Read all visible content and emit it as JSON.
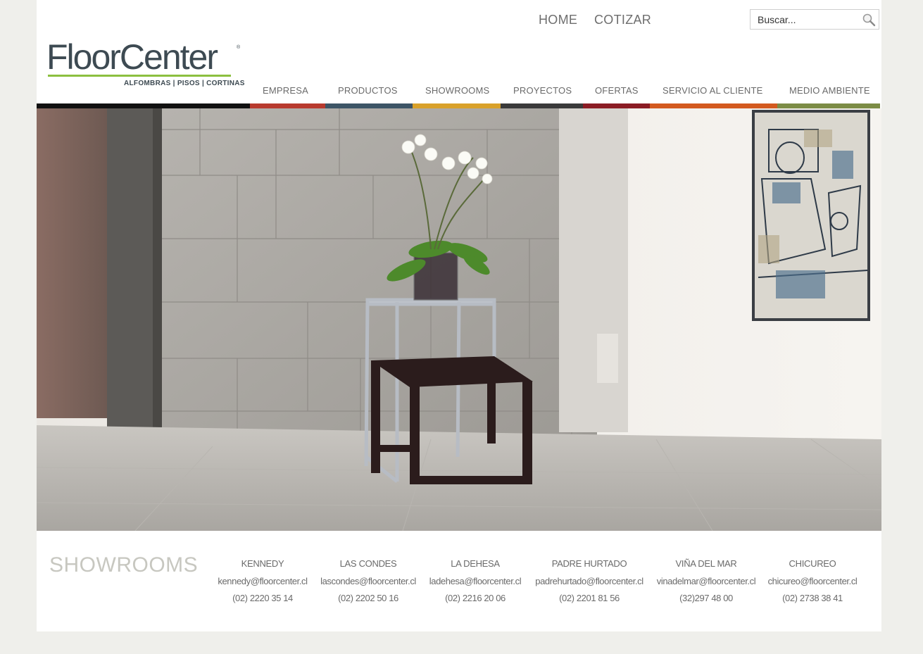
{
  "header": {
    "home_label": "HOME",
    "cotizar_label": "COTIZAR",
    "search_placeholder": "Buscar...",
    "logo_wordmark": "FloorCenter",
    "logo_tagline": "ALFOMBRAS | PISOS | CORTINAS"
  },
  "nav": {
    "items": [
      {
        "label": "EMPRESA",
        "color": "#b83a2e"
      },
      {
        "label": "PRODUCTOS",
        "color": "#3d5566"
      },
      {
        "label": "SHOWROOMS",
        "color": "#d9a12a"
      },
      {
        "label": "PROYECTOS",
        "color": "#3a3a3a"
      },
      {
        "label": "OFERTAS",
        "color": "#8b1c24"
      },
      {
        "label": "SERVICIO AL CLIENTE",
        "color": "#d35a1f"
      },
      {
        "label": "MEDIO AMBIENTE",
        "color": "#7c8c46"
      }
    ]
  },
  "showrooms": {
    "title": "SHOWROOMS",
    "items": [
      {
        "name": "KENNEDY",
        "email": "kennedy@floorcenter.cl",
        "phone": "(02) 2220 35 14"
      },
      {
        "name": "LAS CONDES",
        "email": "lascondes@floorcenter.cl",
        "phone": "(02) 2202 50 16"
      },
      {
        "name": "LA DEHESA",
        "email": "ladehesa@floorcenter.cl",
        "phone": "(02) 2216 20 06"
      },
      {
        "name": "PADRE HURTADO",
        "email": "padrehurtado@floorcenter.cl",
        "phone": "(02) 2201 81 56"
      },
      {
        "name": "VIÑA DEL MAR",
        "email": "vinadelmar@floorcenter.cl",
        "phone": "(32)297 48 00"
      },
      {
        "name": "CHICUREO",
        "email": "chicureo@floorcenter.cl",
        "phone": "(02) 2738 38 41"
      }
    ]
  }
}
